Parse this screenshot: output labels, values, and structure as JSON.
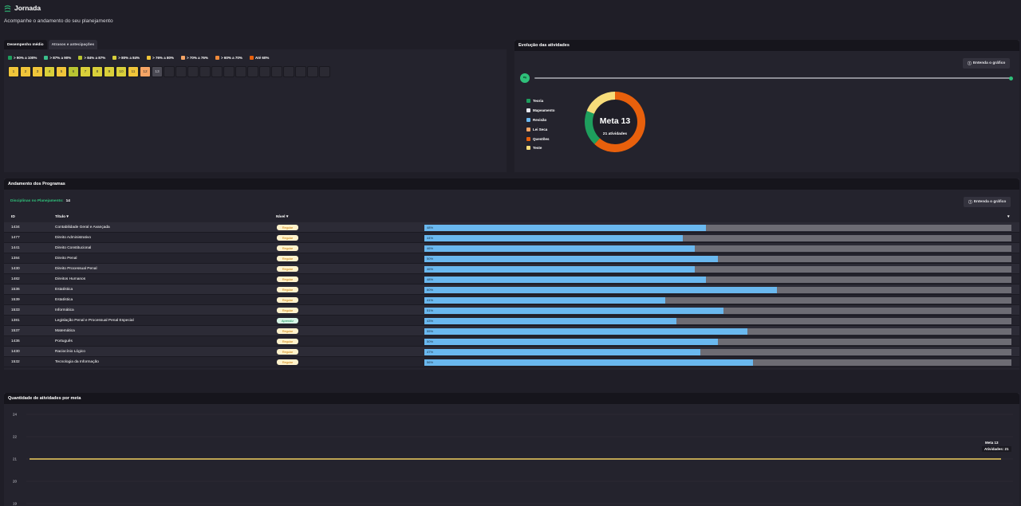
{
  "header": {
    "title": "Jornada",
    "subtitle": "Acompanhe o andamento do seu planejamento"
  },
  "performance": {
    "tabs": [
      "Desempenho médio",
      "Atrasos e antecipações"
    ],
    "legend": [
      {
        "label": "> 90% a 100%",
        "color": "#1e9e5d"
      },
      {
        "label": "> 87% a 90%",
        "color": "#3bbf8c"
      },
      {
        "label": "> 84% a 87%",
        "color": "#b8c432"
      },
      {
        "label": "> 80% a 84%",
        "color": "#d9cf3a"
      },
      {
        "label": "> 76% a 80%",
        "color": "#f0c53a"
      },
      {
        "label": "> 70% a 76%",
        "color": "#f5a465"
      },
      {
        "label": "> 60% a 70%",
        "color": "#f08a3a"
      },
      {
        "label": "Até 60%",
        "color": "#e8600c"
      }
    ],
    "boxes": [
      {
        "label": "1",
        "color": "#f0c53a"
      },
      {
        "label": "2",
        "color": "#f0c53a"
      },
      {
        "label": "3",
        "color": "#f0c53a"
      },
      {
        "label": "4",
        "color": "#d9cf3a"
      },
      {
        "label": "5",
        "color": "#f0c53a"
      },
      {
        "label": "6",
        "color": "#b8c432"
      },
      {
        "label": "7",
        "color": "#d9cf3a"
      },
      {
        "label": "8",
        "color": "#d9cf3a"
      },
      {
        "label": "9",
        "color": "#d9cf3a"
      },
      {
        "label": "10",
        "color": "#d9cf3a"
      },
      {
        "label": "11",
        "color": "#f0c53a"
      },
      {
        "label": "12",
        "color": "#f5a465"
      },
      {
        "label": "13",
        "color": "#4a4953"
      },
      {
        "label": "",
        "color": "#2b2a33"
      },
      {
        "label": "",
        "color": "#2b2a33"
      },
      {
        "label": "",
        "color": "#2b2a33"
      },
      {
        "label": "",
        "color": "#2b2a33"
      },
      {
        "label": "",
        "color": "#2b2a33"
      },
      {
        "label": "",
        "color": "#2b2a33"
      },
      {
        "label": "",
        "color": "#2b2a33"
      },
      {
        "label": "",
        "color": "#2b2a33"
      },
      {
        "label": "",
        "color": "#2b2a33"
      },
      {
        "label": "",
        "color": "#2b2a33"
      },
      {
        "label": "",
        "color": "#2b2a33"
      },
      {
        "label": "",
        "color": "#2b2a33"
      },
      {
        "label": "",
        "color": "#2b2a33"
      },
      {
        "label": "",
        "color": "#2b2a33"
      }
    ]
  },
  "evolution": {
    "title": "Evolução das atividades",
    "button": "Entenda o gráfico",
    "legend": [
      {
        "label": "Teoria",
        "color": "#1e9e5d"
      },
      {
        "label": "Mapeamento",
        "color": "#e8e8ee"
      },
      {
        "label": "Revisão",
        "color": "#6ab8ef"
      },
      {
        "label": "Lei Seca",
        "color": "#f5a465"
      },
      {
        "label": "Questões",
        "color": "#e8600c"
      },
      {
        "label": "Teste",
        "color": "#f7dc7a"
      }
    ],
    "donut": {
      "title": "Meta 13",
      "subtitle": "21 atividades",
      "slices": [
        {
          "label": "Questões",
          "value": 13,
          "color": "#e8600c"
        },
        {
          "label": "Teoria",
          "value": 4,
          "color": "#1e9e5d"
        },
        {
          "label": "Teste",
          "value": 4,
          "color": "#f7dc7a"
        }
      ]
    }
  },
  "programs": {
    "title": "Andamento dos Programas",
    "disc_label": "Disciplinas no Planejamento:",
    "disc_count": "14",
    "columns": {
      "id": "ID",
      "title": "Título",
      "level": "Nível"
    },
    "rows": [
      {
        "id": "1434",
        "title": "Contabilidade Geral e Avançada",
        "level": "Regular",
        "level_type": "yellow",
        "pct": 48,
        "pct_label": "48%"
      },
      {
        "id": "1477",
        "title": "Direito Administrativo",
        "level": "Regular",
        "level_type": "yellow",
        "pct": 44,
        "pct_label": "44%"
      },
      {
        "id": "1441",
        "title": "Direito Constitucional",
        "level": "Regular",
        "level_type": "yellow",
        "pct": 46,
        "pct_label": "46%"
      },
      {
        "id": "1384",
        "title": "Direito Penal",
        "level": "Regular",
        "level_type": "yellow",
        "pct": 50,
        "pct_label": "50%"
      },
      {
        "id": "1430",
        "title": "Direito Processual Penal",
        "level": "Regular",
        "level_type": "yellow",
        "pct": 46,
        "pct_label": "46%"
      },
      {
        "id": "1482",
        "title": "Direitos Humanos",
        "level": "Regular",
        "level_type": "yellow",
        "pct": 48,
        "pct_label": "48%"
      },
      {
        "id": "1536",
        "title": "Estatística",
        "level": "Regular",
        "level_type": "yellow",
        "pct": 60,
        "pct_label": "60%"
      },
      {
        "id": "1539",
        "title": "Estatística",
        "level": "Regular",
        "level_type": "yellow",
        "pct": 41,
        "pct_label": "41%"
      },
      {
        "id": "1533",
        "title": "Informática",
        "level": "Regular",
        "level_type": "yellow",
        "pct": 51,
        "pct_label": "51%"
      },
      {
        "id": "1381",
        "title": "Legislação Penal e Processual Penal Especial",
        "level": "Aprendiz",
        "level_type": "green",
        "pct": 43,
        "pct_label": "43%"
      },
      {
        "id": "1537",
        "title": "Matemática",
        "level": "Regular",
        "level_type": "yellow",
        "pct": 55,
        "pct_label": "55%"
      },
      {
        "id": "1436",
        "title": "Português",
        "level": "Regular",
        "level_type": "yellow",
        "pct": 50,
        "pct_label": "50%"
      },
      {
        "id": "1430",
        "title": "Raciocínio Lógico",
        "level": "Regular",
        "level_type": "yellow",
        "pct": 47,
        "pct_label": "47%"
      },
      {
        "id": "1532",
        "title": "Tecnologia da Informação",
        "level": "Regular",
        "level_type": "yellow",
        "pct": 56,
        "pct_label": "56%"
      }
    ]
  },
  "quantity": {
    "title": "Quantidade de atividades por meta",
    "tooltip_title": "Meta 13",
    "tooltip_value": "Atividades: 21",
    "chart_data": {
      "type": "line",
      "title": "Quantidade de atividades por meta",
      "y_ticks": [
        "24",
        "22",
        "21",
        "20",
        "19"
      ],
      "ylim": [
        19,
        24
      ],
      "series": [
        {
          "values": [
            21,
            21
          ]
        }
      ],
      "line_color": "#f0d060"
    }
  }
}
